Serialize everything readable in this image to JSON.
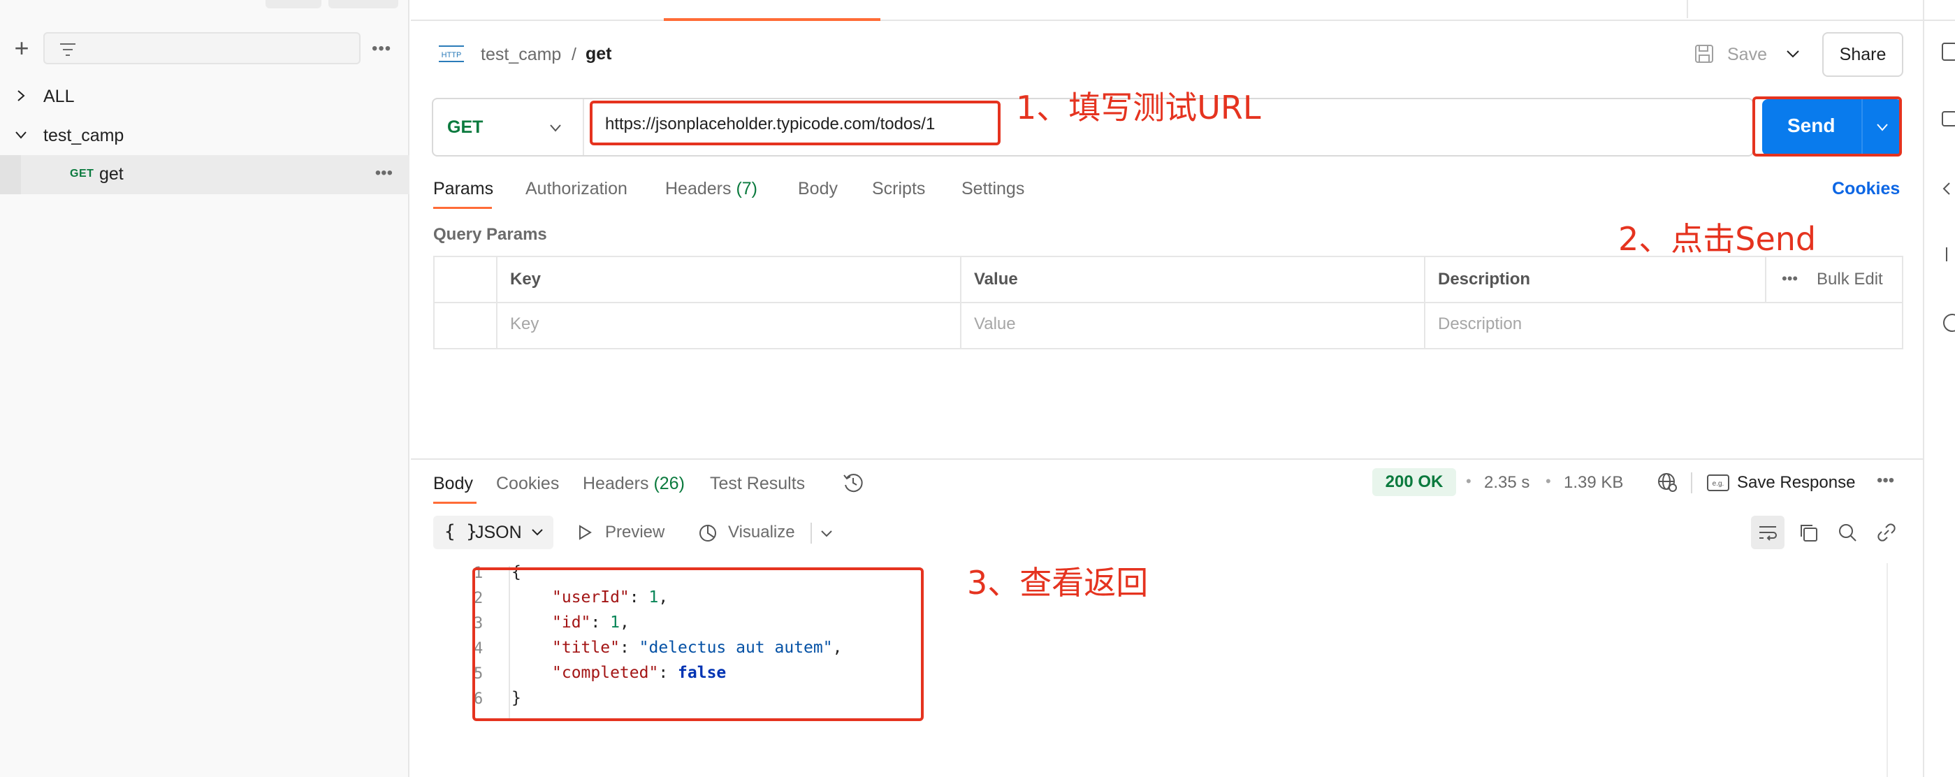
{
  "sidebar": {
    "filter_placeholder": "",
    "items": [
      {
        "label": "ALL",
        "expanded": false
      },
      {
        "label": "test_camp",
        "expanded": true
      },
      {
        "label": "get",
        "method": "GET",
        "selected": true
      }
    ]
  },
  "breadcrumb": {
    "parent": "test_camp",
    "separator": "/",
    "current": "get"
  },
  "toolbar": {
    "save_label": "Save",
    "share_label": "Share"
  },
  "request": {
    "method": "GET",
    "url": "https://jsonplaceholder.typicode.com/todos/1",
    "send_label": "Send",
    "tabs": [
      {
        "label": "Params",
        "active": true
      },
      {
        "label": "Authorization"
      },
      {
        "label": "Headers",
        "count": "(7)"
      },
      {
        "label": "Body"
      },
      {
        "label": "Scripts"
      },
      {
        "label": "Settings"
      }
    ],
    "cookies_label": "Cookies",
    "query_params_label": "Query Params",
    "table": {
      "headers": [
        "Key",
        "Value",
        "Description"
      ],
      "placeholders": [
        "Key",
        "Value",
        "Description"
      ],
      "bulk_edit": "Bulk Edit"
    }
  },
  "response": {
    "tabs": [
      {
        "label": "Body",
        "active": true
      },
      {
        "label": "Cookies"
      },
      {
        "label": "Headers",
        "count": "(26)"
      },
      {
        "label": "Test Results"
      }
    ],
    "status": "200 OK",
    "time": "2.35 s",
    "size": "1.39 KB",
    "save_response_label": "Save Response",
    "format_label": "JSON",
    "format_braces": "{ }",
    "preview_label": "Preview",
    "visualize_label": "Visualize",
    "code_lines": [
      "1",
      "2",
      "3",
      "4",
      "5",
      "6"
    ],
    "json": {
      "open": "{",
      "close": "}",
      "userId_key": "\"userId\"",
      "userId_val": "1",
      "id_key": "\"id\"",
      "id_val": "1",
      "title_key": "\"title\"",
      "title_val": "\"delectus aut autem\"",
      "completed_key": "\"completed\"",
      "completed_val": "false"
    }
  },
  "annotations": {
    "step1": "1、填写测试URL",
    "step2": "2、点击Send",
    "step3": "3、查看返回"
  },
  "colors": {
    "accent": "#ff6c37",
    "send": "#097bed",
    "annotation": "#e5331f",
    "status_ok": "#0b7a3e"
  }
}
